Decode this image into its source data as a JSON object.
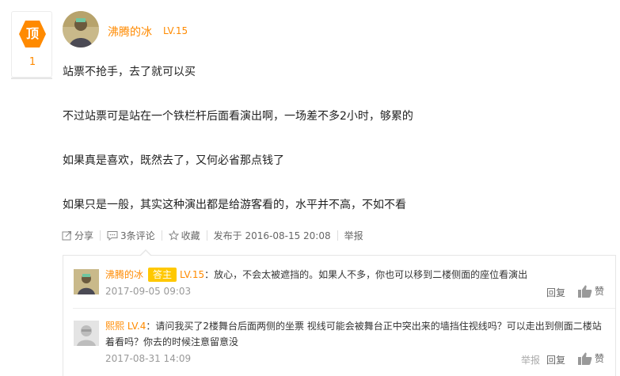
{
  "vote": {
    "label": "顶",
    "count": "1"
  },
  "author": {
    "name": "沸腾的冰",
    "level": "LV.15"
  },
  "post": {
    "paragraphs": [
      "站票不抢手，去了就可以买",
      "不过站票可是站在一个铁栏杆后面看演出啊，一场差不多2小时，够累的",
      "如果真是喜欢，既然去了，又何必省那点钱了",
      "如果只是一般，其实这种演出都是给游客看的，水平并不高，不如不看"
    ]
  },
  "actions": {
    "share": "分享",
    "comments": "3条评论",
    "favorite": "收藏",
    "published": "发布于 2016-08-15 20:08",
    "report": "举报"
  },
  "comments": [
    {
      "name": "沸腾的冰",
      "host_tag": "答主",
      "level": "LV.15",
      "text": "：放心，不会太被遮挡的。如果人不多，你也可以移到二楼侧面的座位看演出",
      "date": "2017-09-05 09:03",
      "reply": "回复",
      "like": "赞"
    },
    {
      "name": "熙熙",
      "level": "LV.4",
      "text_line1": "：请问我买了2楼舞台后面两侧的坐票 视线可能会被舞台正中突出来的墙挡住视线吗？可以走出到侧面二楼站",
      "text_line2": "着看吗？你去的时候注意留意没",
      "date": "2017-08-31 14:09",
      "reply": "举报",
      "reply2": "回复",
      "like": "赞"
    }
  ],
  "colors": {
    "accent": "#ff8a00",
    "host_tag": "#ffc800"
  }
}
